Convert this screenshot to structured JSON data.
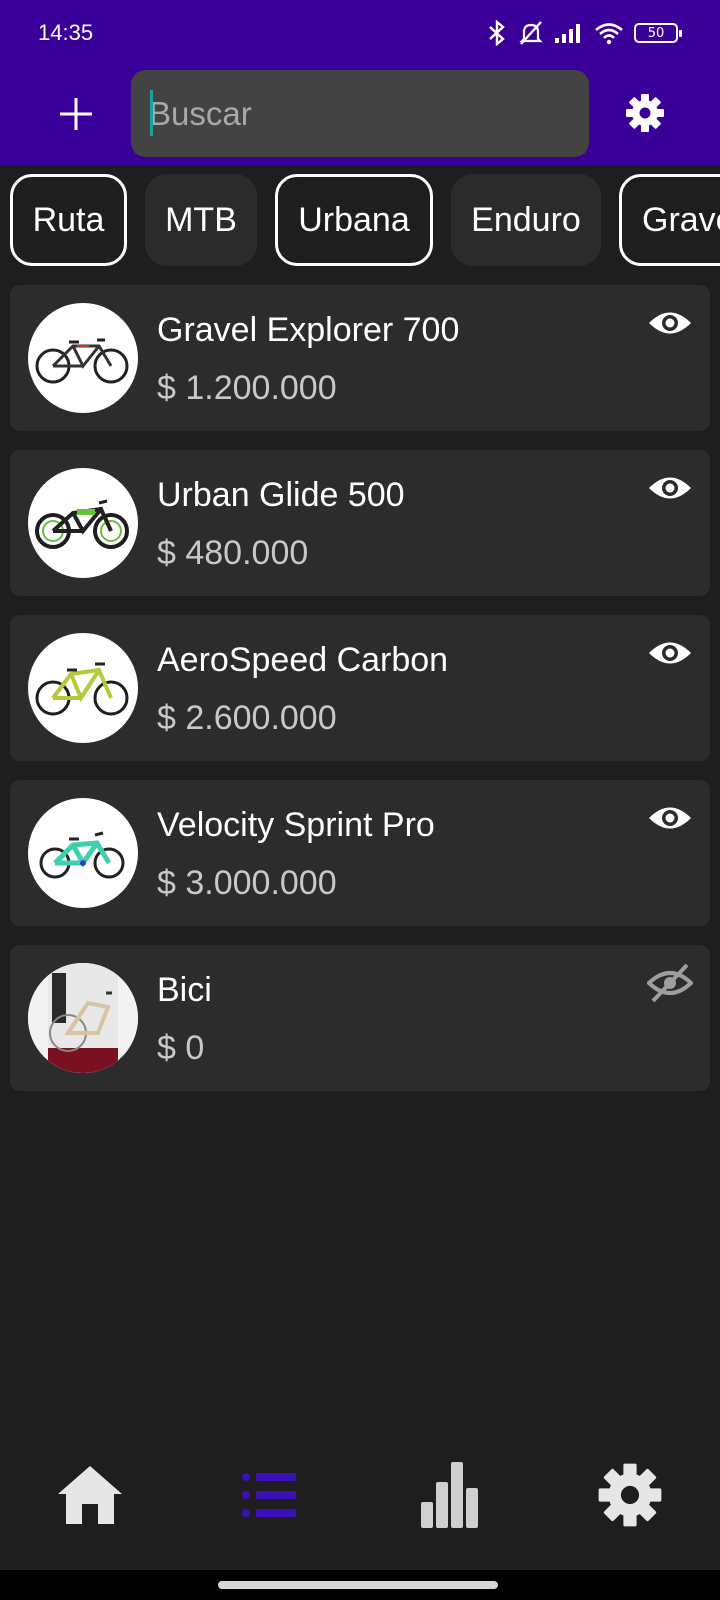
{
  "status_bar": {
    "time": "14:35",
    "battery": "50",
    "icons": [
      "bluetooth-icon",
      "bell-off-icon",
      "signal-icon",
      "wifi-icon",
      "battery-icon"
    ]
  },
  "app_bar": {
    "add_icon": "plus-icon",
    "search": {
      "placeholder": "Buscar",
      "value": ""
    },
    "settings_icon": "gear-icon",
    "background_color": "#3a0099"
  },
  "categories": [
    {
      "label": "Ruta",
      "style": "outlined"
    },
    {
      "label": "MTB",
      "style": "filled"
    },
    {
      "label": "Urbana",
      "style": "outlined"
    },
    {
      "label": "Enduro",
      "style": "filled"
    },
    {
      "label": "Gravel",
      "style": "outlined"
    }
  ],
  "products": [
    {
      "name": "Gravel Explorer 700",
      "price": "$ 1.200.000",
      "visible": true,
      "icon": "eye-icon"
    },
    {
      "name": "Urban Glide 500",
      "price": "$ 480.000",
      "visible": true,
      "icon": "eye-icon"
    },
    {
      "name": "AeroSpeed Carbon",
      "price": "$ 2.600.000",
      "visible": true,
      "icon": "eye-icon"
    },
    {
      "name": "Velocity Sprint Pro",
      "price": "$ 3.000.000",
      "visible": true,
      "icon": "eye-icon"
    },
    {
      "name": "Bici",
      "price": "$ 0",
      "visible": false,
      "icon": "eye-off-icon"
    }
  ],
  "bottom_nav": [
    {
      "icon": "home-icon",
      "active": false
    },
    {
      "icon": "list-icon",
      "active": true
    },
    {
      "icon": "bar-chart-icon",
      "active": false
    },
    {
      "icon": "gear-icon",
      "active": false
    }
  ],
  "colors": {
    "accent": "#3a0099",
    "active_nav": "#3b10b8",
    "background": "#1e1e1e",
    "card": "#2c2c2c"
  }
}
